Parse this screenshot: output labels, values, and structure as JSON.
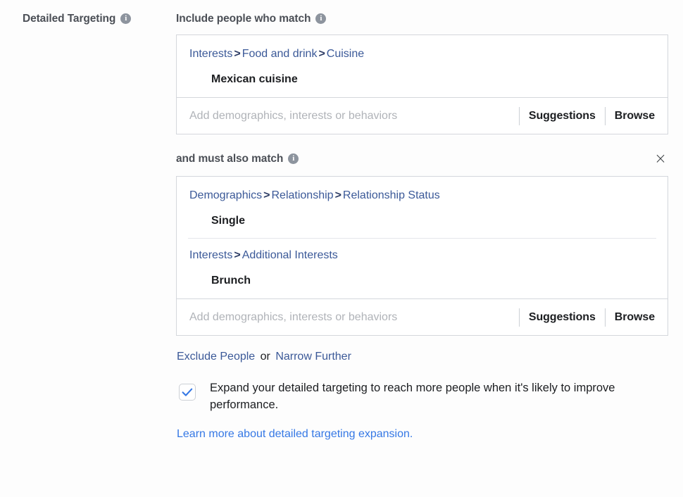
{
  "left_panel": {
    "label": "Detailed Targeting",
    "info_icon": "info-icon"
  },
  "include_section": {
    "label": "Include people who match",
    "info_icon": "info-icon",
    "groups": [
      {
        "breadcrumb": [
          "Interests",
          "Food and drink",
          "Cuisine"
        ],
        "separator": ">",
        "value": "Mexican cuisine"
      }
    ],
    "input": {
      "placeholder": "Add demographics, interests or behaviors",
      "value": "",
      "suggestions_label": "Suggestions",
      "browse_label": "Browse"
    }
  },
  "narrow_section": {
    "label": "and must also match",
    "info_icon": "info-icon",
    "close_icon": "close-icon",
    "close_glyph": "×",
    "groups": [
      {
        "breadcrumb": [
          "Demographics",
          "Relationship",
          "Relationship Status"
        ],
        "separator": ">",
        "value": "Single"
      },
      {
        "breadcrumb": [
          "Interests",
          "Additional Interests"
        ],
        "separator": ">",
        "value": "Brunch"
      }
    ],
    "input": {
      "placeholder": "Add demographics, interests or behaviors",
      "value": "",
      "suggestions_label": "Suggestions",
      "browse_label": "Browse"
    }
  },
  "footer": {
    "exclude_label": "Exclude People",
    "or_text": " or ",
    "narrow_label": "Narrow Further",
    "expansion_checkbox": {
      "checked": true,
      "label": "Expand your detailed targeting to reach more people when it's likely to improve performance."
    },
    "learn_more_label": "Learn more about detailed targeting expansion."
  },
  "colors": {
    "link_blue": "#3b5998",
    "learn_more_blue": "#3578e5",
    "text_dark": "#1c1e21",
    "label_gray": "#4b4f56",
    "placeholder_gray": "#b0b3b8",
    "border_gray": "#d4d7dc",
    "background": "#fdfdfd"
  }
}
